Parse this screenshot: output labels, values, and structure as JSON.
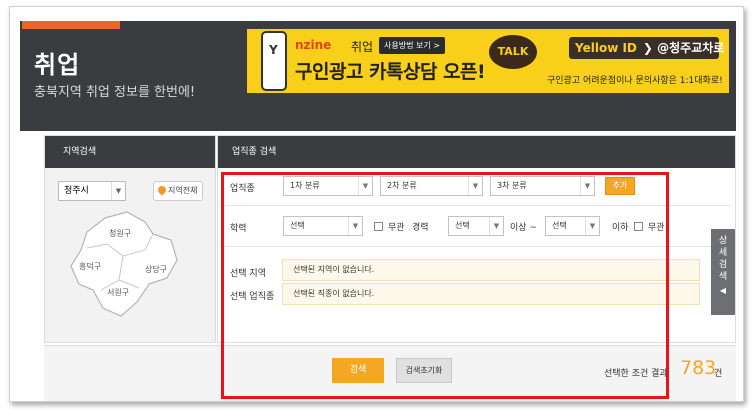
{
  "header": {
    "title": "취업",
    "subtitle": "충북지역 취업 정보를 한번에!"
  },
  "banner": {
    "logo": "nzine",
    "brand": "취업",
    "guide": "사용방법 보기 >",
    "headline": "구인광고 카톡상담 오픈!",
    "talk": "TALK",
    "yellow_id_label": "Yellow ID",
    "yellow_id_value": "❯ @청주교차로",
    "sub": "구인광고 어려운점이나 문의사항은 1:1대화로!"
  },
  "left_panel": {
    "heading": "지역검색",
    "city_select": "청주시",
    "all_region_button": "지역전체",
    "map_labels": [
      "청원구",
      "흥덕구",
      "상당구",
      "서원구"
    ]
  },
  "right_panel": {
    "heading": "업직종 검색",
    "job_label": "업직종",
    "job_selects": [
      "1차 분류",
      "2차 분류",
      "3차 분류"
    ],
    "add_button": "추가",
    "education_label": "학력",
    "education_select": "선택",
    "no_matter_1": "무관",
    "career_label": "경력",
    "career_from": "선택",
    "over_text": "이상 ~",
    "career_to": "선택",
    "under_text": "이하",
    "no_matter_2": "무관",
    "selected_region_label": "선택 지역",
    "selected_region_value": "선택된 지역이 없습니다.",
    "selected_job_label": "선택 업직종",
    "selected_job_value": "선택된 직종이 없습니다."
  },
  "detail_tab": {
    "label": "상세검색",
    "arrow": "◀"
  },
  "bottom": {
    "search_button": "검색",
    "reset_button": "검색초기화",
    "result_prefix": "선택한 조건 결과",
    "result_count": "783",
    "result_unit": "건"
  },
  "colors": {
    "header_bg": "#3a3c40",
    "accent_orange": "#f5a623",
    "banner_yellow": "#f9d019",
    "highlight_red": "#e8141c"
  }
}
